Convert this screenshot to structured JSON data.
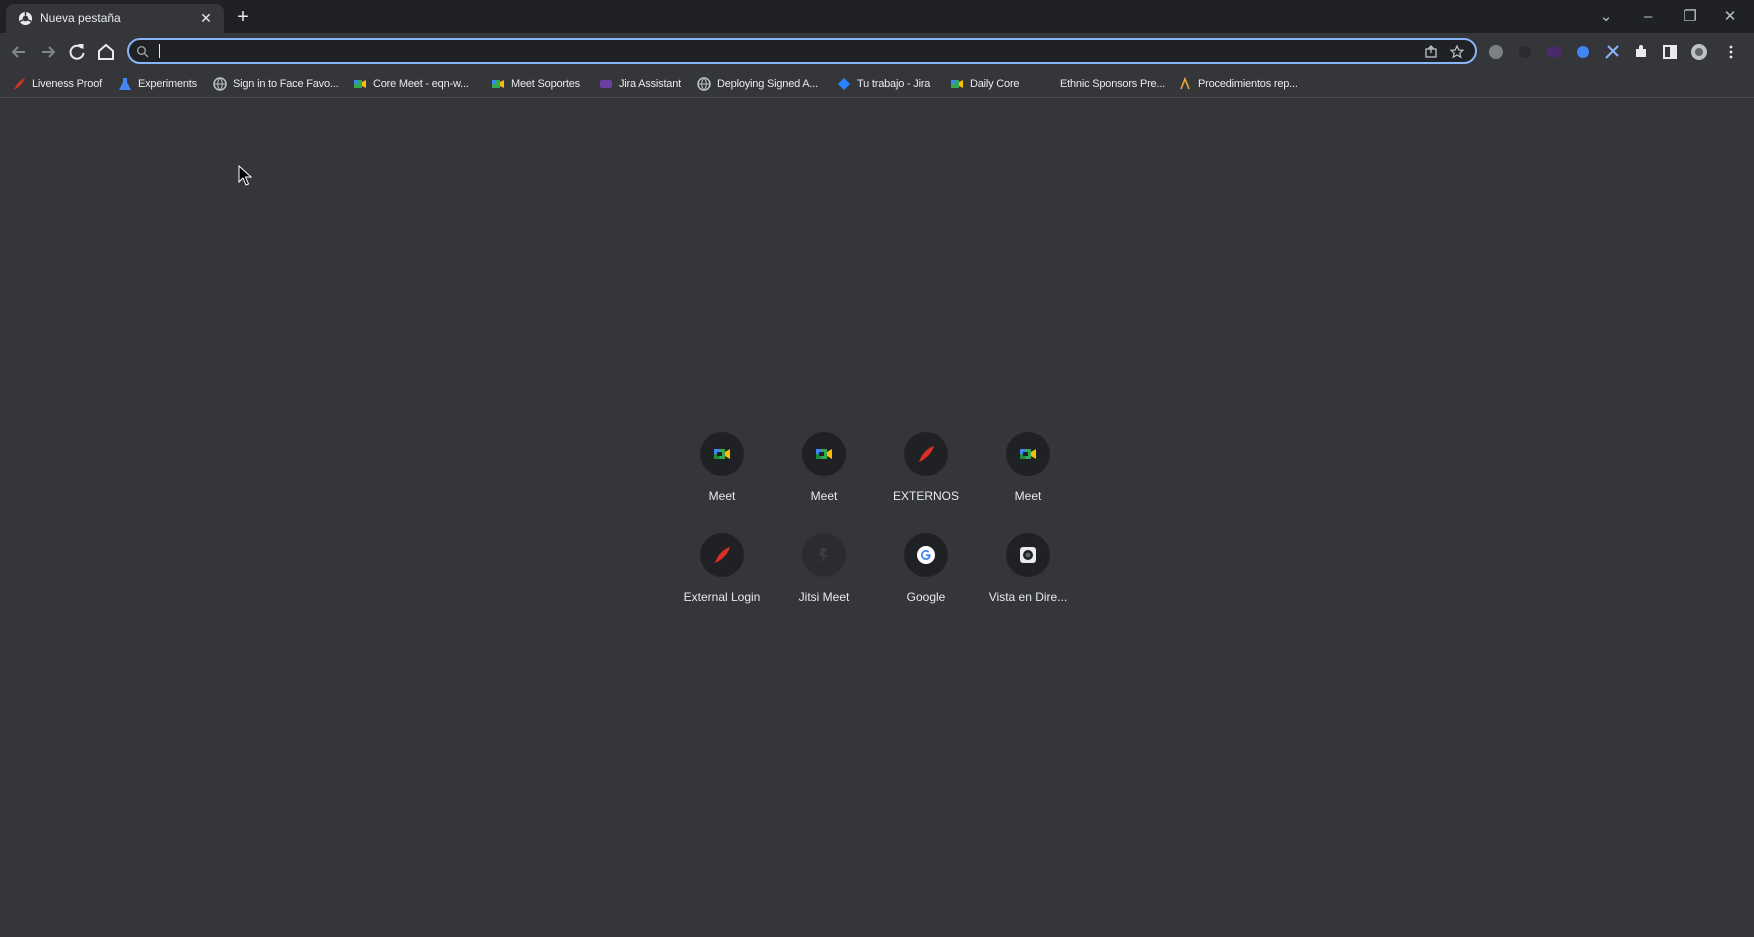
{
  "tab": {
    "title": "Nueva pestaña",
    "close": "✕",
    "new_tab": "+"
  },
  "window_controls": {
    "dropdown": "⌄",
    "minimize": "–",
    "restore": "❐",
    "close": "✕"
  },
  "omnibox": {
    "value": "",
    "placeholder": ""
  },
  "bookmarks": [
    {
      "label": "Liveness Proof",
      "icon": "feather-red-icon"
    },
    {
      "label": "Experiments",
      "icon": "flask-icon"
    },
    {
      "label": "Sign in to Face Favo...",
      "icon": "globe-icon"
    },
    {
      "label": "Core Meet - eqn-w...",
      "icon": "meet-icon"
    },
    {
      "label": "Meet Soportes",
      "icon": "meet-icon"
    },
    {
      "label": "Jira Assistant",
      "icon": "jira-assistant-icon"
    },
    {
      "label": "Deploying Signed A...",
      "icon": "globe-icon"
    },
    {
      "label": "Tu trabajo - Jira",
      "icon": "jira-icon"
    },
    {
      "label": "Daily Core",
      "icon": "meet-icon"
    },
    {
      "label": "Ethnic Sponsors Pre...",
      "icon": "blank-icon"
    },
    {
      "label": "Procedimientos rep...",
      "icon": "procedures-icon"
    }
  ],
  "shortcuts": [
    {
      "label": "Meet",
      "icon": "meet-icon"
    },
    {
      "label": "Meet",
      "icon": "meet-icon"
    },
    {
      "label": "EXTERNOS",
      "icon": "feather-red-icon"
    },
    {
      "label": "Meet",
      "icon": "meet-icon"
    },
    {
      "label": "External Login",
      "icon": "feather-red-icon"
    },
    {
      "label": "Jitsi Meet",
      "icon": "jitsi-icon"
    },
    {
      "label": "Google",
      "icon": "google-icon"
    },
    {
      "label": "Vista en Dire...",
      "icon": "camera-icon"
    }
  ],
  "colors": {
    "frame": "#202124",
    "toolbar": "#35363a",
    "accent": "#8ab4f8",
    "text": "#e8eaed"
  }
}
